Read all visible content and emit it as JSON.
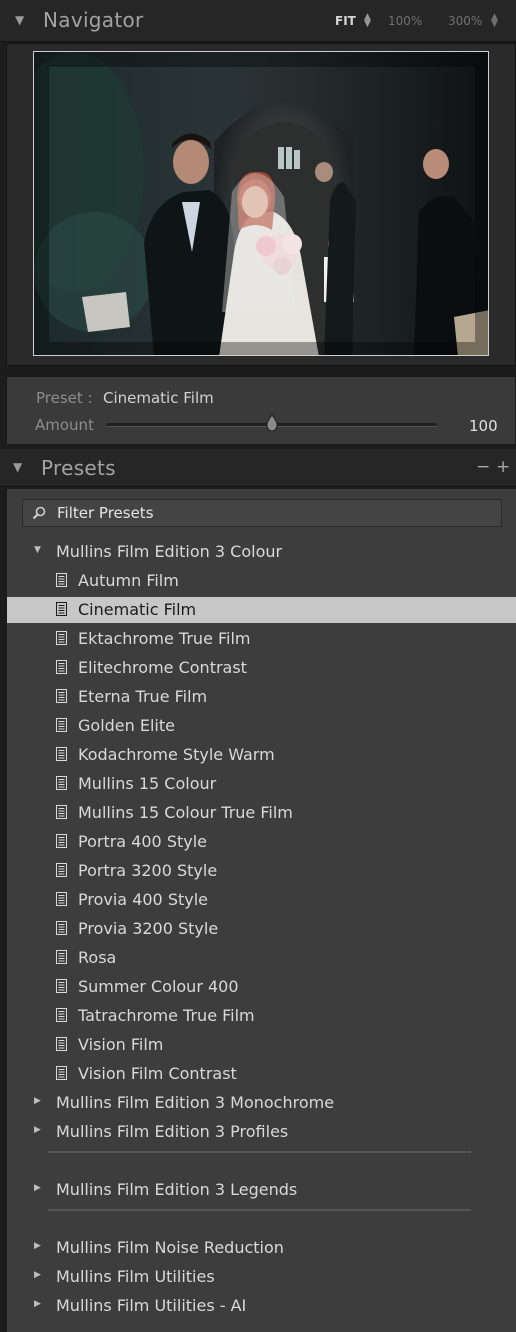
{
  "navigator": {
    "title": "Navigator",
    "zoom_fit": "FIT",
    "zoom_100": "100%",
    "zoom_300": "300%"
  },
  "preset_amount": {
    "preset_label": "Preset :",
    "preset_value": "Cinematic Film",
    "amount_label": "Amount",
    "amount_value": "100"
  },
  "presets": {
    "title": "Presets",
    "remove_label": "−",
    "add_label": "+",
    "filter_placeholder": "Filter Presets",
    "groups": [
      {
        "name": "Mullins Film Edition 3 Colour",
        "expanded": true,
        "items": [
          "Autumn Film",
          "Cinematic Film",
          "Ektachrome True Film",
          "Elitechrome Contrast",
          "Eterna True Film",
          "Golden Elite",
          "Kodachrome Style Warm",
          "Mullins 15 Colour",
          "Mullins 15 Colour True Film",
          "Portra 400 Style",
          "Portra 3200 Style",
          "Provia 400 Style",
          "Provia 3200 Style",
          "Rosa",
          "Summer Colour 400",
          "Tatrachrome True Film",
          "Vision Film",
          "Vision Film Contrast"
        ],
        "selected": "Cinematic Film"
      },
      {
        "name": "Mullins Film Edition 3 Monochrome",
        "expanded": false
      },
      {
        "name": "Mullins Film Edition 3 Profiles",
        "expanded": false
      },
      {
        "name": "Mullins Film Edition 3 Legends",
        "expanded": false
      },
      {
        "name": "Mullins Film Noise Reduction",
        "expanded": false
      },
      {
        "name": "Mullins Film Utilities",
        "expanded": false
      },
      {
        "name": "Mullins Film Utilities - AI",
        "expanded": false
      }
    ]
  },
  "icons": {
    "collapse": "triangle-down-icon",
    "expand": "triangle-right-icon",
    "preset": "preset-document-icon",
    "filter": "search-icon"
  },
  "colors": {
    "selected_row": "#c7c7c7",
    "panel_bg": "#3d3d3d",
    "header_bg": "#262626"
  }
}
